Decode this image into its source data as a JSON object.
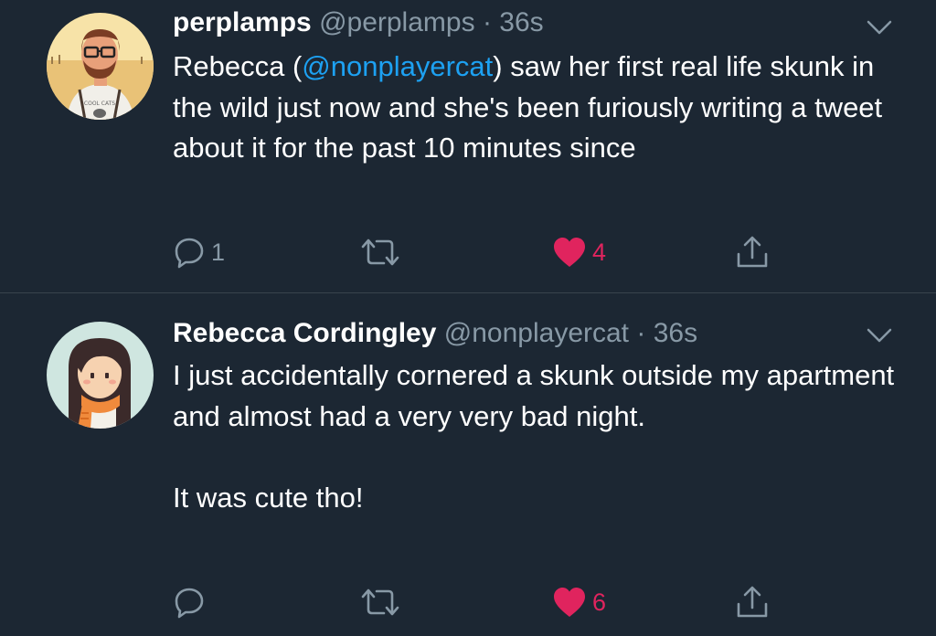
{
  "tweets": [
    {
      "display_name": "perplamps",
      "handle": "@perplamps",
      "separator": "·",
      "time": "36s",
      "text_before": "Rebecca (",
      "mention": "@nonplayercat",
      "text_after": ") saw her first real life skunk in the wild just now and she's been furiously writing a tweet about it for the past 10 minutes since",
      "reply_count": "1",
      "like_count": "4",
      "liked": true
    },
    {
      "display_name": "Rebecca Cordingley",
      "handle": "@nonplayercat",
      "separator": "·",
      "time": "36s",
      "text_line1": "I just accidentally cornered a skunk outside my apartment and almost had a very very bad night.",
      "text_line2": "It was cute tho!",
      "reply_count": "",
      "like_count": "6",
      "liked": true
    }
  ],
  "avatar_shirt_text": "COOL CATS",
  "colors": {
    "background": "#1c2733",
    "divider": "#38444d",
    "secondary_text": "#8899a6",
    "mention": "#1da1f2",
    "like": "#e0245e"
  },
  "icons": [
    "avatar-perplamps",
    "avatar-nonplayercat",
    "chevron-down-icon",
    "reply-icon",
    "retweet-icon",
    "heart-icon",
    "share-icon"
  ]
}
